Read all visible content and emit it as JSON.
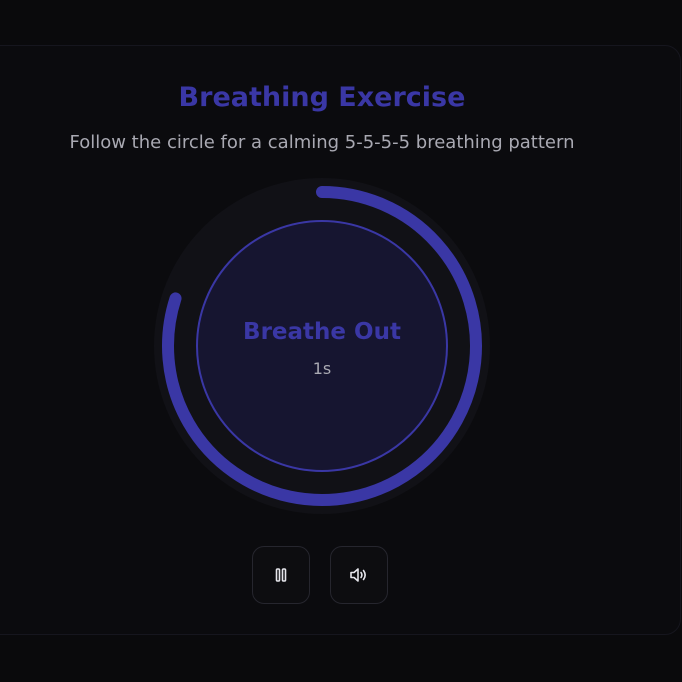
{
  "header": {
    "title": "Breathing Exercise",
    "subtitle": "Follow the circle for a calming 5-5-5-5 breathing pattern"
  },
  "breathing": {
    "phase": "Breathe Out",
    "remaining": "1s",
    "progress": 0.8
  },
  "controls": {
    "pause_icon": "pause-icon",
    "sound_icon": "volume-icon"
  },
  "colors": {
    "accent": "#3a37a5",
    "inner_fill": "#161530",
    "outer_track": "#111116",
    "background": "#0a0a0c",
    "muted_text": "#a9a9b2",
    "icon": "#e6e6ec"
  }
}
